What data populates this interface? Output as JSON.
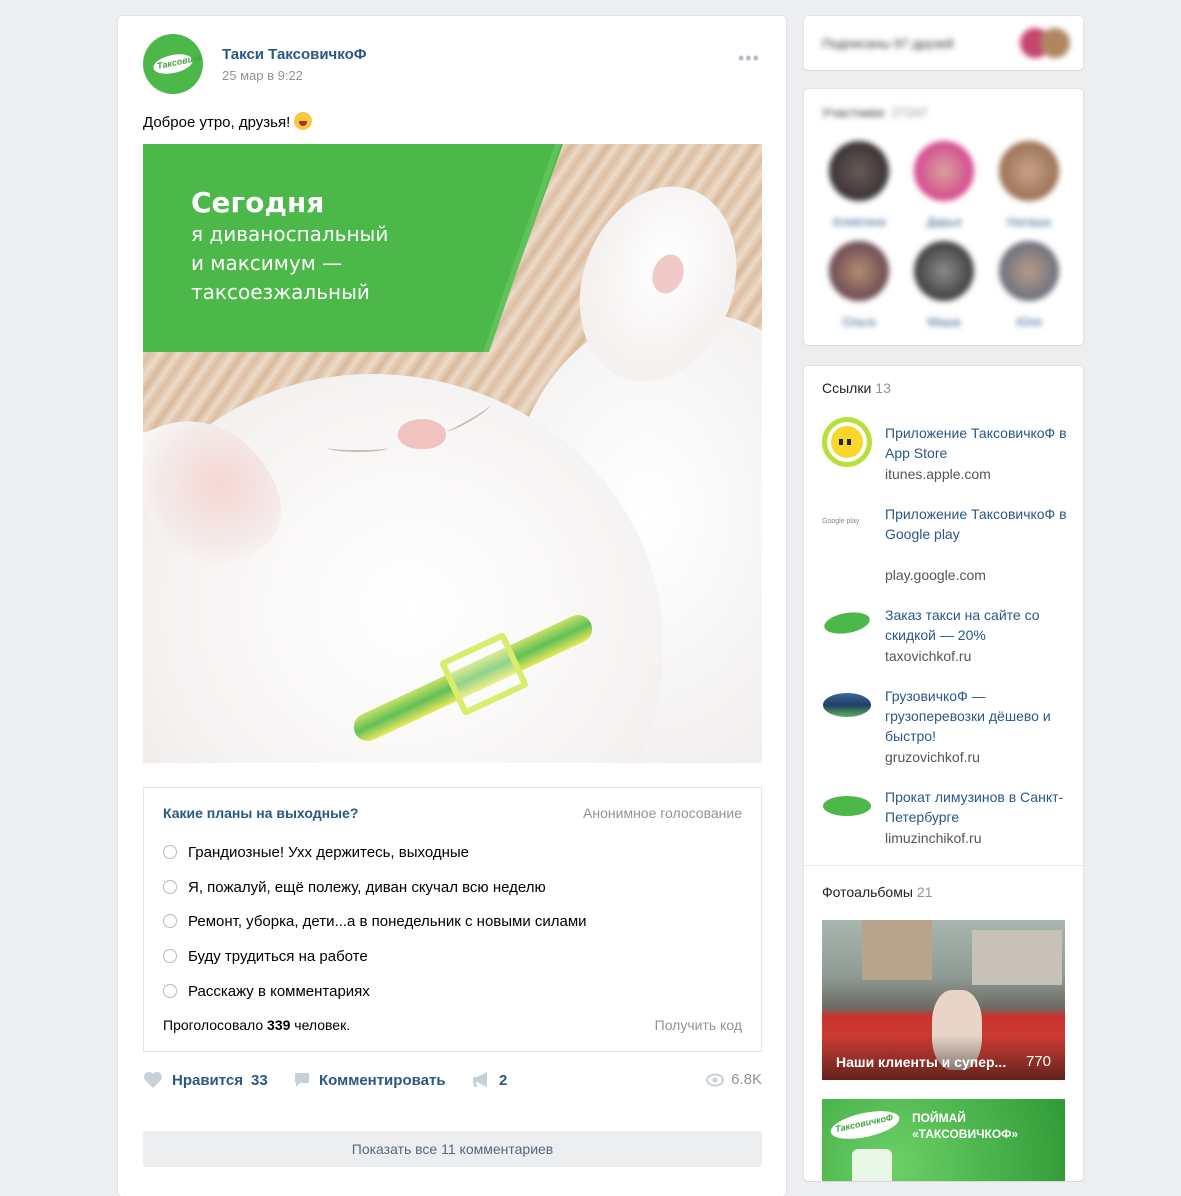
{
  "post": {
    "author": "Такси ТаксовичкоФ",
    "date": "25 мар в 9:22",
    "text": "Доброе утро, друзья!",
    "menu": "•••",
    "avatar_logo_text": "ТаксовичкоФ",
    "image": {
      "title": "Сегодня",
      "line1": "я диваноспальный",
      "line2": "и максимум —",
      "line3": "таксоезжальный"
    },
    "poll": {
      "question": "Какие планы на выходные?",
      "type": "Анонимное голосование",
      "options": [
        "Грандиозные! Ухх держитесь, выходные",
        "Я, пожалуй, ещё полежу, диван скучал всю неделю",
        "Ремонт, уборка, дети...а в понедельник с новыми силами",
        "Буду трудиться на работе",
        "Расскажу в комментариях"
      ],
      "voted_prefix": "Проголосовало",
      "voted_count": "339",
      "voted_suffix": "человек.",
      "get_code": "Получить код"
    },
    "actions": {
      "like_label": "Нравится",
      "like_count": "33",
      "comment_label": "Комментировать",
      "share_count": "2",
      "views": "6.8K"
    },
    "show_all_comments": "Показать все 11 комментариев"
  },
  "sidebar": {
    "friends_text": "Подписаны 97 друзей",
    "members": {
      "title": "Участники",
      "count": "27247",
      "items": [
        {
          "name": "Алевтина"
        },
        {
          "name": "Дарья"
        },
        {
          "name": "Наташа"
        },
        {
          "name": "Ольга"
        },
        {
          "name": "Маша"
        },
        {
          "name": "Юля"
        }
      ]
    },
    "links": {
      "title": "Ссылки",
      "count": "13",
      "items": [
        {
          "title": "Приложение ТаксовичкоФ в App Store",
          "domain": "itunes.apple.com"
        },
        {
          "title": "Приложение ТаксовичкоФ в Google play",
          "domain": "play.google.com"
        },
        {
          "title": "Заказ такси на сайте со скидкой — 20%",
          "domain": "taxovichkof.ru"
        },
        {
          "title": "ГрузовичкоФ — грузоперевозки дёшево и быстро!",
          "domain": "gruzovichkof.ru"
        },
        {
          "title": "Прокат лимузинов в Санкт-Петербурге",
          "domain": "limuzinchikof.ru"
        }
      ]
    },
    "albums": {
      "title": "Фотоальбомы",
      "count": "21",
      "first_caption": "Наши клиенты и супер...",
      "first_count": "770",
      "second_text1": "ПОЙМАЙ",
      "second_text2": "«ТАКСОВИЧКОФ»",
      "second_logo": "ТаксовичкоФ"
    },
    "google_play_label": "Google play"
  },
  "colors": {
    "brand_green": "#4cb84a",
    "link_blue": "#2a5885",
    "page_bg": "#edeef0"
  },
  "icons": [
    "heart-icon",
    "comment-icon",
    "megaphone-icon",
    "eye-icon",
    "dots-icon"
  ]
}
